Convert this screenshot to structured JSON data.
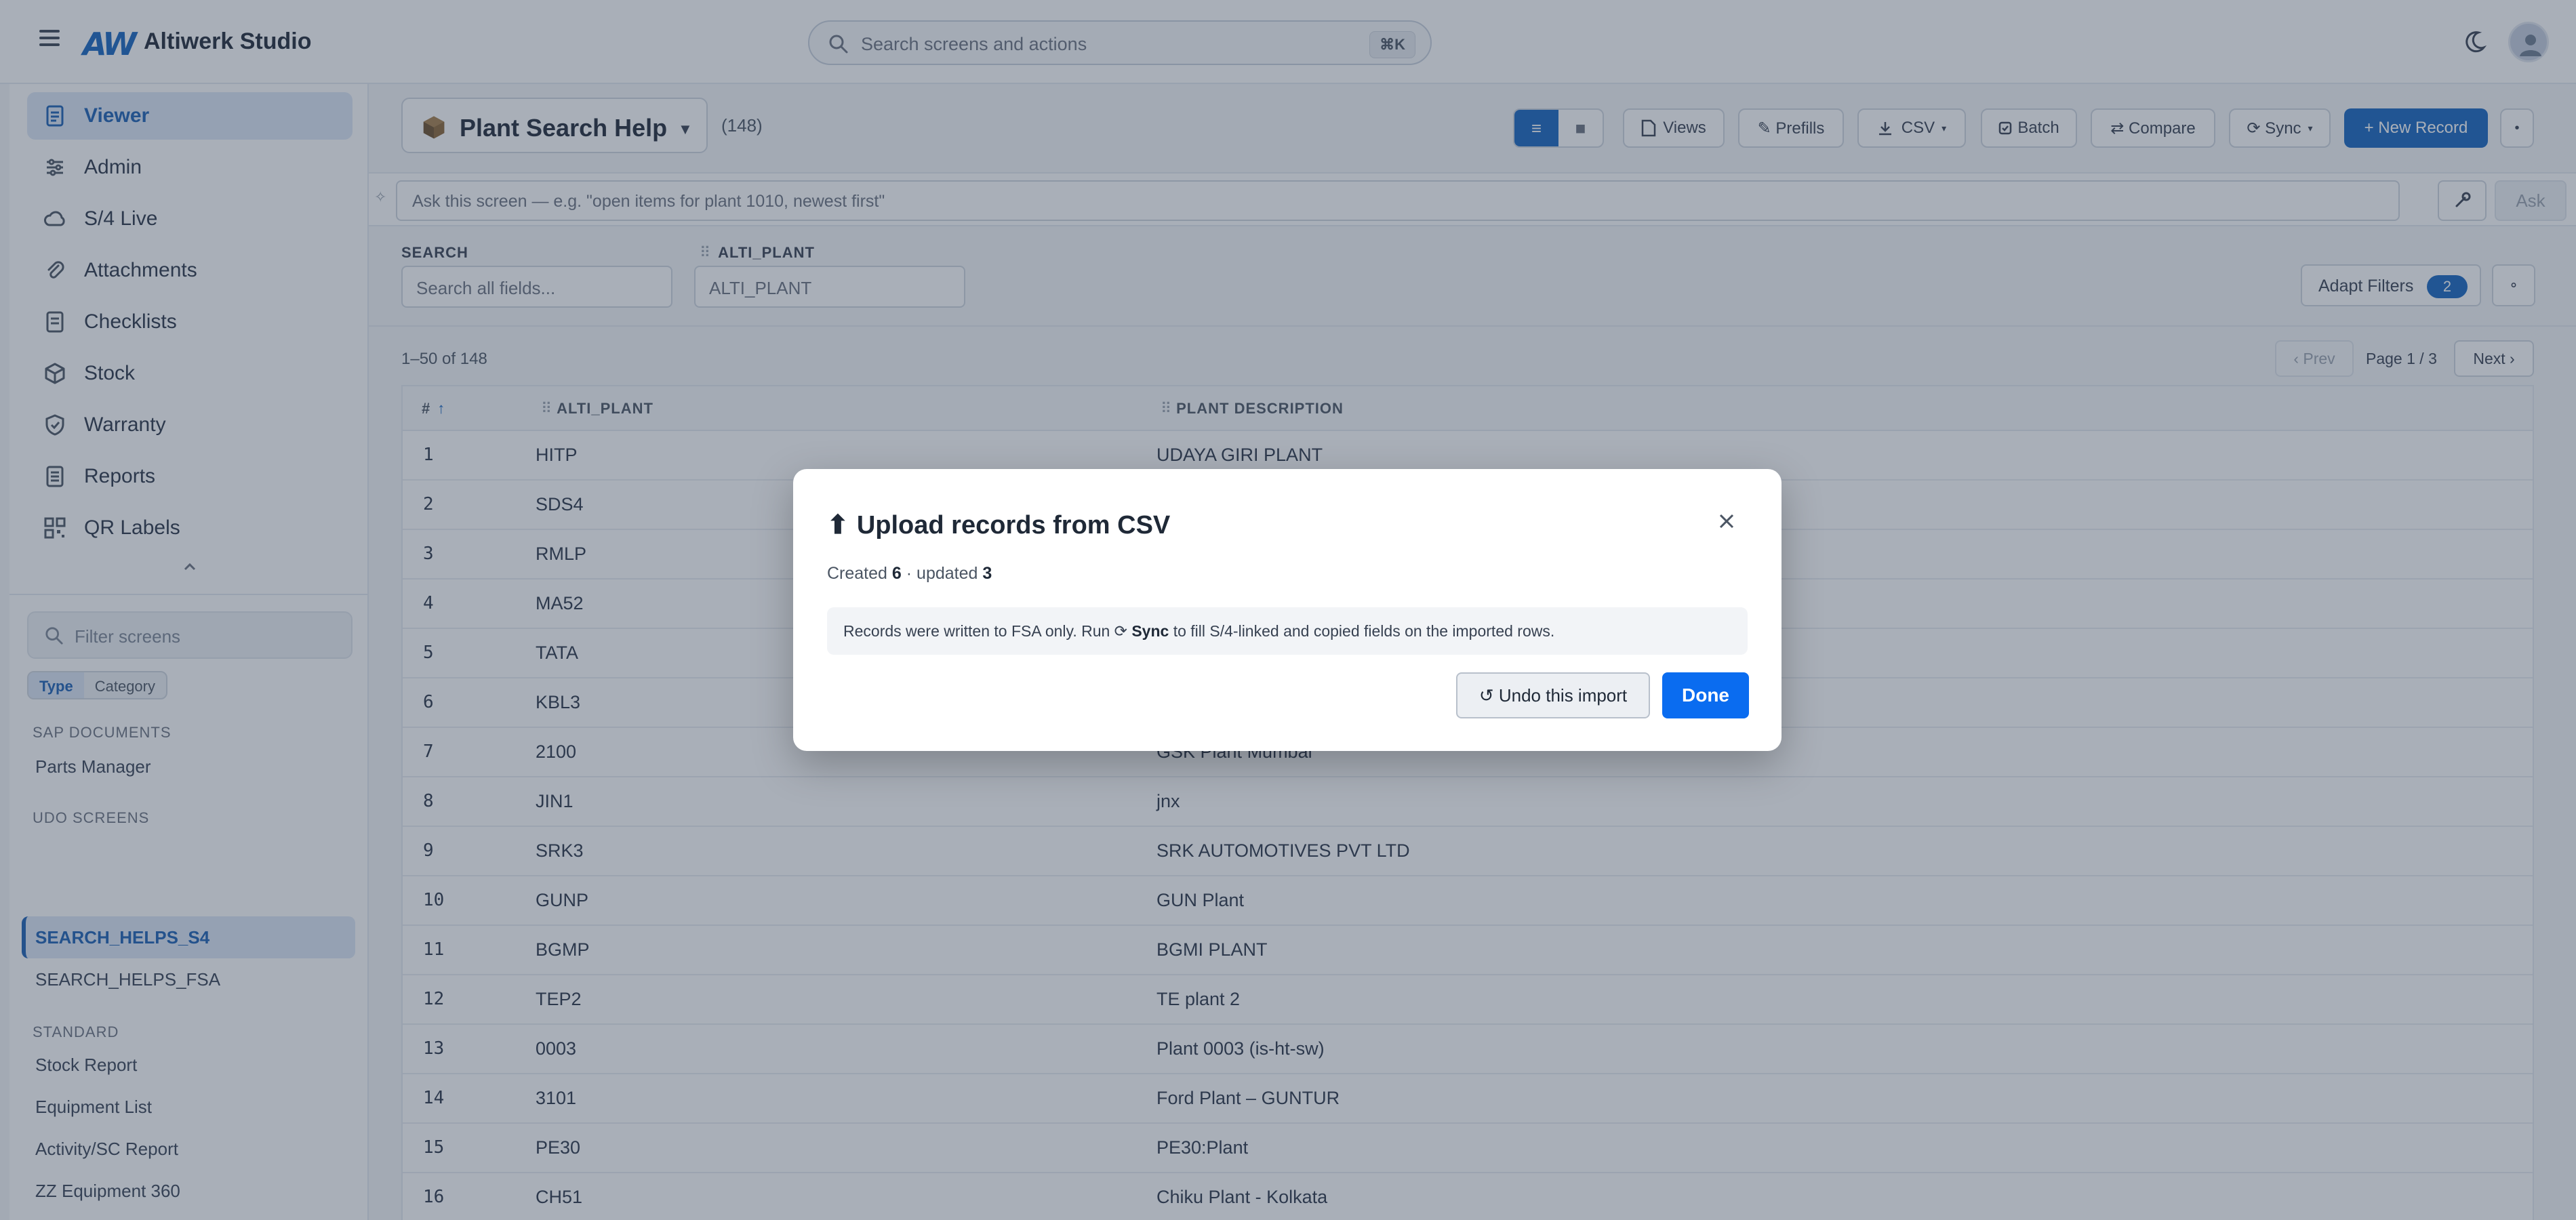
{
  "header": {
    "logo_text": "AW",
    "app_title": "Altiwerk Studio",
    "search_placeholder": "Search screens and actions",
    "search_shortcut": "⌘K"
  },
  "sidebar": {
    "nav": [
      {
        "label": "Viewer",
        "icon": "document-icon",
        "active": true
      },
      {
        "label": "Admin",
        "icon": "sliders-icon",
        "active": false
      },
      {
        "label": "S/4 Live",
        "icon": "cloud-icon",
        "active": false
      },
      {
        "label": "Attachments",
        "icon": "paperclip-icon",
        "active": false
      },
      {
        "label": "Checklists",
        "icon": "checklist-icon",
        "active": false
      },
      {
        "label": "Stock",
        "icon": "box-icon",
        "active": false
      },
      {
        "label": "Warranty",
        "icon": "shield-icon",
        "active": false
      },
      {
        "label": "Reports",
        "icon": "report-icon",
        "active": false
      },
      {
        "label": "QR Labels",
        "icon": "qr-icon",
        "active": false
      }
    ],
    "filter_placeholder": "Filter screens",
    "segment": {
      "type": "Type",
      "category": "Category",
      "selected": "Type"
    },
    "sections": [
      {
        "heading": "SAP DOCUMENTS",
        "items": [
          "Parts Manager"
        ]
      },
      {
        "heading": "UDO SCREENS",
        "items": [
          "SEARCH_HELPS_S4",
          "SEARCH_HELPS_FSA"
        ],
        "active_item": "SEARCH_HELPS_S4"
      },
      {
        "heading": "STANDARD",
        "items": [
          "Stock Report",
          "Equipment List",
          "Activity/SC Report",
          "ZZ Equipment 360"
        ]
      }
    ]
  },
  "screen": {
    "title": "Plant Search Help",
    "count": "(148)",
    "toolbar": {
      "views": "Views",
      "prefills": "✎ Prefills",
      "csv": "CSV",
      "batch": "Batch",
      "compare": "⇄ Compare",
      "sync": "⟳ Sync",
      "new_record": "+ New Record"
    },
    "ask_placeholder": "Ask this screen — e.g. \"open items for plant 1010, newest first\"",
    "ask_button": "Ask",
    "filters": {
      "search_label": "SEARCH",
      "search_placeholder": "Search all fields...",
      "plant_label": "ALTI_PLANT",
      "plant_placeholder": "ALTI_PLANT",
      "adapt_label": "Adapt Filters",
      "adapt_count": "2"
    },
    "pagination": {
      "range": "1–50 of 148",
      "prev": "‹ Prev",
      "page": "Page 1 / 3",
      "next": "Next ›"
    },
    "table": {
      "columns": [
        "#",
        "ALTI_PLANT",
        "PLANT DESCRIPTION"
      ],
      "rows": [
        {
          "n": "1",
          "code": "HITP",
          "desc": "UDAYA GIRI PLANT"
        },
        {
          "n": "2",
          "code": "SDS4",
          "desc": ""
        },
        {
          "n": "3",
          "code": "RMLP",
          "desc": ""
        },
        {
          "n": "4",
          "code": "MA52",
          "desc": ""
        },
        {
          "n": "5",
          "code": "TATA",
          "desc": ""
        },
        {
          "n": "6",
          "code": "KBL3",
          "desc": ""
        },
        {
          "n": "7",
          "code": "2100",
          "desc": "GSK Plant Mumbai"
        },
        {
          "n": "8",
          "code": "JIN1",
          "desc": "jnx"
        },
        {
          "n": "9",
          "code": "SRK3",
          "desc": "SRK AUTOMOTIVES PVT LTD"
        },
        {
          "n": "10",
          "code": "GUNP",
          "desc": "GUN Plant"
        },
        {
          "n": "11",
          "code": "BGMP",
          "desc": "BGMI PLANT"
        },
        {
          "n": "12",
          "code": "TEP2",
          "desc": "TE plant 2"
        },
        {
          "n": "13",
          "code": "0003",
          "desc": "Plant 0003 (is-ht-sw)"
        },
        {
          "n": "14",
          "code": "3101",
          "desc": "Ford Plant – GUNTUR"
        },
        {
          "n": "15",
          "code": "PE30",
          "desc": "PE30:Plant"
        },
        {
          "n": "16",
          "code": "CH51",
          "desc": "Chiku Plant - Kolkata"
        }
      ]
    }
  },
  "modal": {
    "title": "Upload records from CSV",
    "created_label": "Created",
    "created": "6",
    "updated_label": "· updated",
    "updated": "3",
    "note_before": "Records were written to FSA only. Run ⟳",
    "note_bold": "Sync",
    "note_after": "to fill S/4-linked and copied fields on the imported rows.",
    "undo": "↺ Undo this import",
    "done": "Done"
  },
  "colors": {
    "accent": "#1565c0",
    "done_button": "#0a6cf0",
    "overlay": "#334155"
  }
}
